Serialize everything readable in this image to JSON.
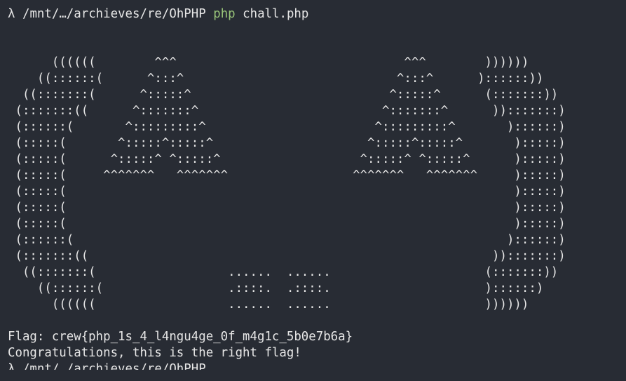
{
  "colors": {
    "background": "#282c34",
    "text": "#e6e6e6",
    "command_green": "#98c379"
  },
  "prompt": {
    "symbol": "λ",
    "path": "/mnt/…/archieves/re/OhPHP",
    "command": "php",
    "argument": "chall.php"
  },
  "ascii_art": [
    "      ((((((        ^^^                               ^^^        ))))))",
    "    ((::::::(      ^:::^                             ^:::^      )::::::))",
    "  ((:::::::(      ^:::::^                           ^:::::^      (:::::::))",
    " (:::::::((      ^:::::::^                         ^:::::::^      )):::::::)",
    " (::::::(       ^:::::::::^                       ^:::::::::^       )::::::)",
    " (:::::(       ^:::::^:::::^                     ^:::::^:::::^       ):::::)",
    " (:::::(      ^:::::^ ^:::::^                   ^:::::^ ^:::::^      ):::::)",
    " (:::::(     ^^^^^^^   ^^^^^^^                 ^^^^^^^   ^^^^^^^     ):::::)",
    " (:::::(                                                             ):::::)",
    " (:::::(                                                             ):::::)",
    " (:::::(                                                             ):::::)",
    " (::::::(                                                           )::::::)",
    " (:::::::((                                                       )):::::::)",
    "  ((:::::::(                  ......  ......                     (:::::::))",
    "    ((::::::(                 .::::.  .::::.                     )::::::)",
    "      ((((((                  ......  ......                     ))))))"
  ],
  "output": {
    "flag_line": "Flag: crew{php_1s_4_l4ngu4ge_0f_m4g1c_5b0e7b6a}",
    "congrats_line": "Congratulations, this is the right flag!",
    "partial_line": "λ /mnt/…/archieves/re/OhPHP"
  }
}
